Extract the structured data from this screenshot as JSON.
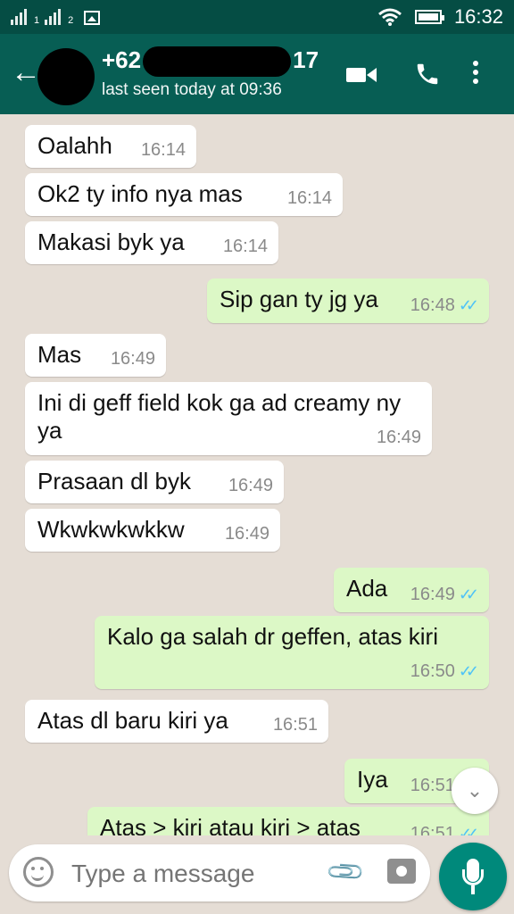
{
  "status_bar": {
    "time": "16:32",
    "sim1": "1",
    "sim2": "2"
  },
  "header": {
    "back_icon": "arrow-left-icon",
    "name_prefix": "+62",
    "name_suffix": "17",
    "last_seen": "last seen today at 09:36"
  },
  "messages": [
    {
      "text": "Oalahh",
      "time": "16:14",
      "direction": "in"
    },
    {
      "text": "Ok2 ty info nya mas",
      "time": "16:14",
      "direction": "in"
    },
    {
      "text": "Makasi byk ya",
      "time": "16:14",
      "direction": "in"
    },
    {
      "text": "Sip gan ty jg ya",
      "time": "16:48",
      "direction": "out",
      "ticks": "✓✓"
    },
    {
      "text": "Mas",
      "time": "16:49",
      "direction": "in"
    },
    {
      "text": "Ini di geff field kok ga ad creamy ny ya",
      "time": "16:49",
      "direction": "in"
    },
    {
      "text": "Prasaan dl byk",
      "time": "16:49",
      "direction": "in"
    },
    {
      "text": "Wkwkwkwkkw",
      "time": "16:49",
      "direction": "in"
    },
    {
      "text": "Ada",
      "time": "16:49",
      "direction": "out",
      "ticks": "✓✓"
    },
    {
      "text": "Kalo ga salah dr geffen, atas kiri",
      "time": "16:50",
      "direction": "out",
      "ticks": "✓✓"
    },
    {
      "text": "Atas dl baru kiri ya",
      "time": "16:51",
      "direction": "in"
    },
    {
      "text": "Iya",
      "time": "16:51",
      "direction": "out",
      "ticks": "✓✓"
    },
    {
      "text": "Atas > kiri atau kiri > atas",
      "time": "16:51",
      "direction": "out",
      "ticks": "✓✓"
    }
  ],
  "composer": {
    "placeholder": "Type a message"
  },
  "colors": {
    "status_bar": "#054d44",
    "app_bar": "#075e54",
    "chat_bg": "#e5ddd5",
    "outgoing": "#dcf8c6",
    "incoming": "#ffffff",
    "read_ticks": "#4fc3f7",
    "fab": "#00897b"
  }
}
